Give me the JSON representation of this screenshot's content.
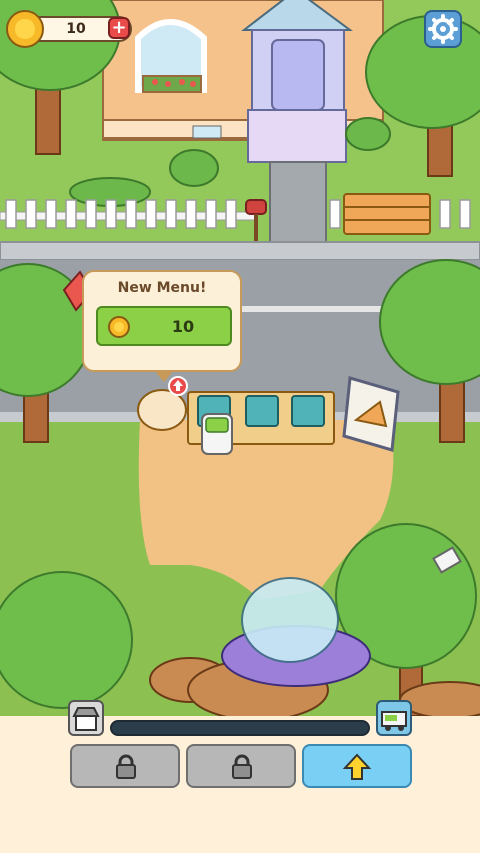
{
  "hud": {
    "coin_count": "10",
    "plus_label": "+",
    "icons": {
      "coin": "coin-icon",
      "settings": "gear-icon"
    }
  },
  "popup": {
    "title": "New Menu!",
    "cost": "10"
  },
  "bottom_bar": {
    "progress_fraction": 0,
    "slots": [
      {
        "state": "locked",
        "icon": "lock-icon"
      },
      {
        "state": "locked",
        "icon": "lock-icon"
      },
      {
        "state": "upgrade",
        "icon": "up-arrow-icon"
      }
    ],
    "left_icon": "shop-icon",
    "right_icon": "food-truck-icon"
  },
  "colors": {
    "grass": "#8cc152",
    "road": "#9aa0a6",
    "dirt": "#f2c184",
    "popup_bg": "#fdf0d8",
    "popup_button": "#8bd046",
    "panel_bg": "#fff0da",
    "upgrade_button": "#79d0f4",
    "locked_button": "#b7b7b7"
  }
}
